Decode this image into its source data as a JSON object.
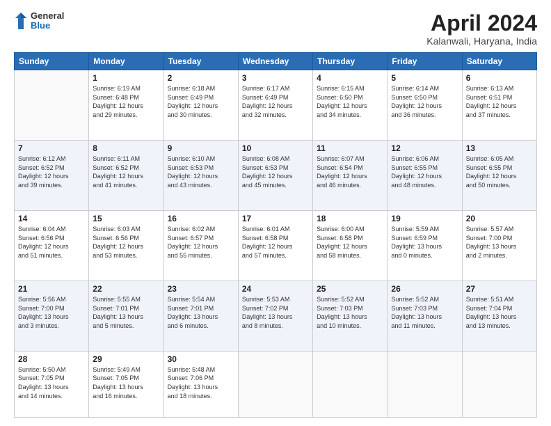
{
  "logo": {
    "general": "General",
    "blue": "Blue"
  },
  "header": {
    "title": "April 2024",
    "subtitle": "Kalanwali, Haryana, India"
  },
  "weekdays": [
    "Sunday",
    "Monday",
    "Tuesday",
    "Wednesday",
    "Thursday",
    "Friday",
    "Saturday"
  ],
  "weeks": [
    [
      {
        "day": "",
        "info": ""
      },
      {
        "day": "1",
        "info": "Sunrise: 6:19 AM\nSunset: 6:48 PM\nDaylight: 12 hours\nand 29 minutes."
      },
      {
        "day": "2",
        "info": "Sunrise: 6:18 AM\nSunset: 6:49 PM\nDaylight: 12 hours\nand 30 minutes."
      },
      {
        "day": "3",
        "info": "Sunrise: 6:17 AM\nSunset: 6:49 PM\nDaylight: 12 hours\nand 32 minutes."
      },
      {
        "day": "4",
        "info": "Sunrise: 6:15 AM\nSunset: 6:50 PM\nDaylight: 12 hours\nand 34 minutes."
      },
      {
        "day": "5",
        "info": "Sunrise: 6:14 AM\nSunset: 6:50 PM\nDaylight: 12 hours\nand 36 minutes."
      },
      {
        "day": "6",
        "info": "Sunrise: 6:13 AM\nSunset: 6:51 PM\nDaylight: 12 hours\nand 37 minutes."
      }
    ],
    [
      {
        "day": "7",
        "info": "Sunrise: 6:12 AM\nSunset: 6:52 PM\nDaylight: 12 hours\nand 39 minutes."
      },
      {
        "day": "8",
        "info": "Sunrise: 6:11 AM\nSunset: 6:52 PM\nDaylight: 12 hours\nand 41 minutes."
      },
      {
        "day": "9",
        "info": "Sunrise: 6:10 AM\nSunset: 6:53 PM\nDaylight: 12 hours\nand 43 minutes."
      },
      {
        "day": "10",
        "info": "Sunrise: 6:08 AM\nSunset: 6:53 PM\nDaylight: 12 hours\nand 45 minutes."
      },
      {
        "day": "11",
        "info": "Sunrise: 6:07 AM\nSunset: 6:54 PM\nDaylight: 12 hours\nand 46 minutes."
      },
      {
        "day": "12",
        "info": "Sunrise: 6:06 AM\nSunset: 6:55 PM\nDaylight: 12 hours\nand 48 minutes."
      },
      {
        "day": "13",
        "info": "Sunrise: 6:05 AM\nSunset: 6:55 PM\nDaylight: 12 hours\nand 50 minutes."
      }
    ],
    [
      {
        "day": "14",
        "info": "Sunrise: 6:04 AM\nSunset: 6:56 PM\nDaylight: 12 hours\nand 51 minutes."
      },
      {
        "day": "15",
        "info": "Sunrise: 6:03 AM\nSunset: 6:56 PM\nDaylight: 12 hours\nand 53 minutes."
      },
      {
        "day": "16",
        "info": "Sunrise: 6:02 AM\nSunset: 6:57 PM\nDaylight: 12 hours\nand 55 minutes."
      },
      {
        "day": "17",
        "info": "Sunrise: 6:01 AM\nSunset: 6:58 PM\nDaylight: 12 hours\nand 57 minutes."
      },
      {
        "day": "18",
        "info": "Sunrise: 6:00 AM\nSunset: 6:58 PM\nDaylight: 12 hours\nand 58 minutes."
      },
      {
        "day": "19",
        "info": "Sunrise: 5:59 AM\nSunset: 6:59 PM\nDaylight: 13 hours\nand 0 minutes."
      },
      {
        "day": "20",
        "info": "Sunrise: 5:57 AM\nSunset: 7:00 PM\nDaylight: 13 hours\nand 2 minutes."
      }
    ],
    [
      {
        "day": "21",
        "info": "Sunrise: 5:56 AM\nSunset: 7:00 PM\nDaylight: 13 hours\nand 3 minutes."
      },
      {
        "day": "22",
        "info": "Sunrise: 5:55 AM\nSunset: 7:01 PM\nDaylight: 13 hours\nand 5 minutes."
      },
      {
        "day": "23",
        "info": "Sunrise: 5:54 AM\nSunset: 7:01 PM\nDaylight: 13 hours\nand 6 minutes."
      },
      {
        "day": "24",
        "info": "Sunrise: 5:53 AM\nSunset: 7:02 PM\nDaylight: 13 hours\nand 8 minutes."
      },
      {
        "day": "25",
        "info": "Sunrise: 5:52 AM\nSunset: 7:03 PM\nDaylight: 13 hours\nand 10 minutes."
      },
      {
        "day": "26",
        "info": "Sunrise: 5:52 AM\nSunset: 7:03 PM\nDaylight: 13 hours\nand 11 minutes."
      },
      {
        "day": "27",
        "info": "Sunrise: 5:51 AM\nSunset: 7:04 PM\nDaylight: 13 hours\nand 13 minutes."
      }
    ],
    [
      {
        "day": "28",
        "info": "Sunrise: 5:50 AM\nSunset: 7:05 PM\nDaylight: 13 hours\nand 14 minutes."
      },
      {
        "day": "29",
        "info": "Sunrise: 5:49 AM\nSunset: 7:05 PM\nDaylight: 13 hours\nand 16 minutes."
      },
      {
        "day": "30",
        "info": "Sunrise: 5:48 AM\nSunset: 7:06 PM\nDaylight: 13 hours\nand 18 minutes."
      },
      {
        "day": "",
        "info": ""
      },
      {
        "day": "",
        "info": ""
      },
      {
        "day": "",
        "info": ""
      },
      {
        "day": "",
        "info": ""
      }
    ]
  ]
}
